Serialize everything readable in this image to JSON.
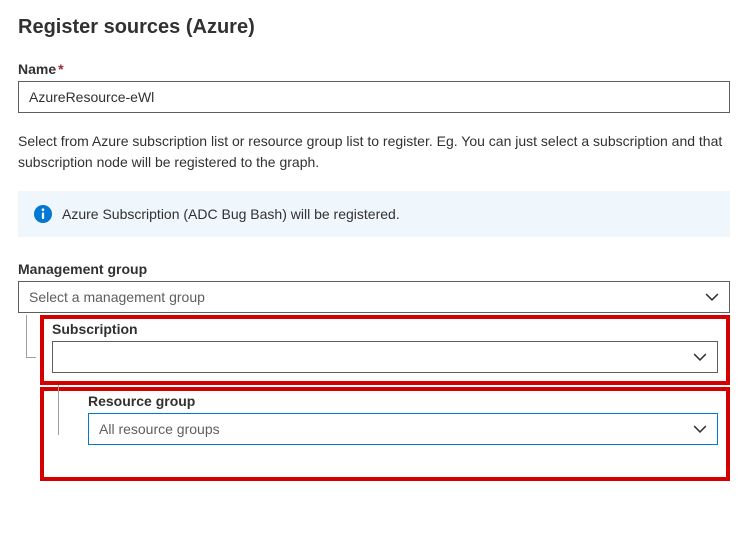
{
  "page": {
    "title": "Register sources (Azure)"
  },
  "name": {
    "label": "Name",
    "required_mark": "*",
    "value": "AzureResource-eWl"
  },
  "helper": "Select from Azure subscription list or resource group list to register. Eg. You can just select a subscription and that subscription node will be registered to the graph.",
  "banner": {
    "text": "Azure Subscription (ADC Bug Bash) will be registered."
  },
  "mgmt": {
    "label": "Management group",
    "placeholder": "Select a management group"
  },
  "subscription": {
    "label": "Subscription",
    "value": ""
  },
  "resource_group": {
    "label": "Resource group",
    "value": "All resource groups"
  }
}
